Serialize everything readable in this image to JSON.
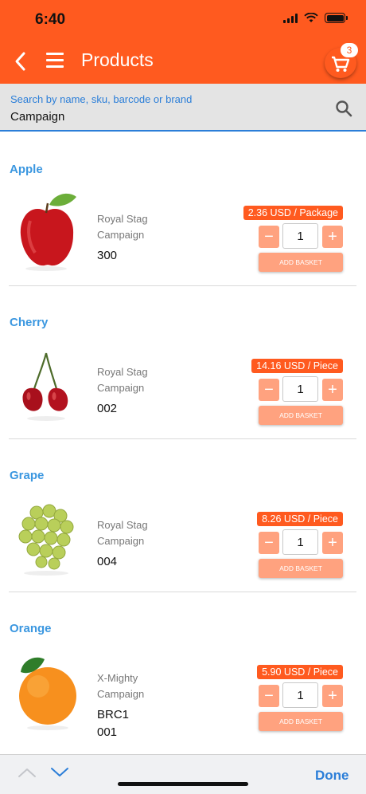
{
  "status_bar": {
    "time": "6:40"
  },
  "header": {
    "title": "Products",
    "cart_count": "3",
    "icons": {
      "back": "chevron-left-icon",
      "menu": "hamburger-menu-icon",
      "cart": "shopping-cart-icon"
    }
  },
  "search": {
    "label": "Search by name, sku, barcode or brand",
    "value": "Campaign",
    "icon": "search-icon"
  },
  "products": [
    {
      "name": "Apple",
      "brand": "Royal Stag",
      "tag": "Campaign",
      "code": "300",
      "price": "2.36 USD / Package",
      "qty": "1",
      "add_label": "ADD BASKET",
      "image": "apple"
    },
    {
      "name": "Cherry",
      "brand": "Royal Stag",
      "tag": "Campaign",
      "code": "002",
      "price": "14.16 USD / Piece",
      "qty": "1",
      "add_label": "ADD BASKET",
      "image": "cherry"
    },
    {
      "name": "Grape",
      "brand": "Royal Stag",
      "tag": "Campaign",
      "code": "004",
      "price": "8.26 USD / Piece",
      "qty": "1",
      "add_label": "ADD BASKET",
      "image": "grape"
    },
    {
      "name": "Orange",
      "brand": "X-Mighty",
      "tag": "Campaign",
      "code": "BRC1",
      "code2": "001",
      "price": "5.90 USD / Piece",
      "qty": "1",
      "add_label": "ADD BASKET",
      "image": "orange"
    }
  ],
  "qty_controls": {
    "minus": "−",
    "plus": "+"
  },
  "keyboard_toolbar": {
    "done_label": "Done"
  },
  "colors": {
    "accent": "#ff5a1f",
    "accent_light": "#ffa27f",
    "link_blue": "#2b7ed8",
    "title_blue": "#3b97e0"
  }
}
